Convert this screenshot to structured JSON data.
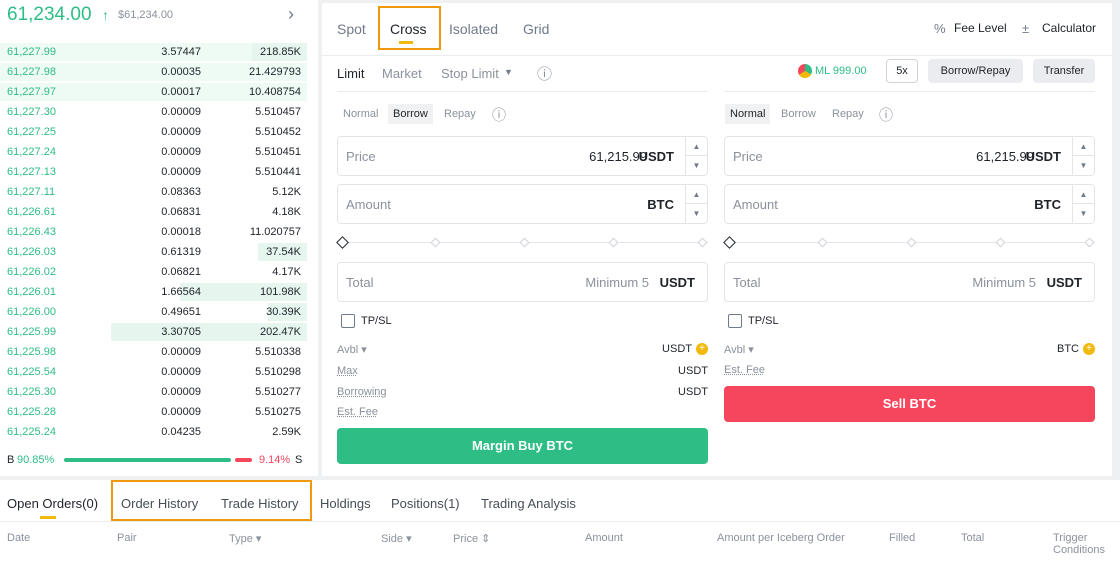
{
  "orderbook": {
    "last_price": "61,234.00",
    "arrow": "↑",
    "mark_price": "$61,234.00",
    "chevron": "›",
    "rows": [
      {
        "price": "61,227.99",
        "qty": "3.57447",
        "total": "218.85K",
        "depth": 0.28,
        "hl": true
      },
      {
        "price": "61,227.98",
        "qty": "0.00035",
        "total": "21.429793",
        "depth": 0.0,
        "hl": true
      },
      {
        "price": "61,227.97",
        "qty": "0.00017",
        "total": "10.408754",
        "depth": 0.0,
        "hl": true
      },
      {
        "price": "61,227.30",
        "qty": "0.00009",
        "total": "5.510457",
        "depth": 0.0,
        "hl": false
      },
      {
        "price": "61,227.25",
        "qty": "0.00009",
        "total": "5.510452",
        "depth": 0.0,
        "hl": false
      },
      {
        "price": "61,227.24",
        "qty": "0.00009",
        "total": "5.510451",
        "depth": 0.0,
        "hl": false
      },
      {
        "price": "61,227.13",
        "qty": "0.00009",
        "total": "5.510441",
        "depth": 0.0,
        "hl": false
      },
      {
        "price": "61,227.11",
        "qty": "0.08363",
        "total": "5.12K",
        "depth": 0.0,
        "hl": false
      },
      {
        "price": "61,226.61",
        "qty": "0.06831",
        "total": "4.18K",
        "depth": 0.0,
        "hl": false
      },
      {
        "price": "61,226.43",
        "qty": "0.00018",
        "total": "11.020757",
        "depth": 0.0,
        "hl": false
      },
      {
        "price": "61,226.03",
        "qty": "0.61319",
        "total": "37.54K",
        "depth": 0.25,
        "hl": false
      },
      {
        "price": "61,226.02",
        "qty": "0.06821",
        "total": "4.17K",
        "depth": 0.0,
        "hl": false
      },
      {
        "price": "61,226.01",
        "qty": "1.66564",
        "total": "101.98K",
        "depth": 0.65,
        "hl": false
      },
      {
        "price": "61,226.00",
        "qty": "0.49651",
        "total": "30.39K",
        "depth": 0.2,
        "hl": false
      },
      {
        "price": "61,225.99",
        "qty": "3.30705",
        "total": "202.47K",
        "depth": 1.0,
        "hl": false
      },
      {
        "price": "61,225.98",
        "qty": "0.00009",
        "total": "5.510338",
        "depth": 0.0,
        "hl": false
      },
      {
        "price": "61,225.54",
        "qty": "0.00009",
        "total": "5.510298",
        "depth": 0.0,
        "hl": false
      },
      {
        "price": "61,225.30",
        "qty": "0.00009",
        "total": "5.510277",
        "depth": 0.0,
        "hl": false
      },
      {
        "price": "61,225.28",
        "qty": "0.00009",
        "total": "5.510275",
        "depth": 0.0,
        "hl": false
      },
      {
        "price": "61,225.24",
        "qty": "0.04235",
        "total": "2.59K",
        "depth": 0.0,
        "hl": false
      }
    ],
    "ratio_buy_label": "B",
    "ratio_buy": "90.85%",
    "ratio_sell": "9.14%",
    "ratio_sell_label": "S",
    "buy_fraction": 0.9085
  },
  "tabs": {
    "spot": "Spot",
    "cross": "Cross",
    "isolated": "Isolated",
    "grid": "Grid",
    "fee_level": "Fee Level",
    "calculator": "Calculator"
  },
  "order_types": {
    "limit": "Limit",
    "market": "Market",
    "stop_limit": "Stop Limit",
    "info": "ⓘ"
  },
  "margin": {
    "ml": "ML 999.00",
    "leverage": "5x",
    "borrow_repay": "Borrow/Repay",
    "transfer": "Transfer"
  },
  "buy": {
    "mode": {
      "normal": "Normal",
      "borrow": "Borrow",
      "repay": "Repay",
      "info": "ⓘ"
    },
    "price_label": "Price",
    "price_value": "61,215.99",
    "price_unit": "USDT",
    "amount_label": "Amount",
    "amount_unit": "BTC",
    "total_label": "Total",
    "total_placeholder": "Minimum 5",
    "total_unit": "USDT",
    "tpsl": "TP/SL",
    "avbl_label": "Avbl ▾",
    "avbl_unit": "USDT",
    "max_label": "Max",
    "max_unit": "USDT",
    "borrowing_label": "Borrowing",
    "borrowing_unit": "USDT",
    "fee_label": "Est. Fee",
    "button": "Margin Buy BTC"
  },
  "sell": {
    "mode": {
      "normal": "Normal",
      "borrow": "Borrow",
      "repay": "Repay",
      "info": "ⓘ"
    },
    "price_label": "Price",
    "price_value": "61,215.99",
    "price_unit": "USDT",
    "amount_label": "Amount",
    "amount_unit": "BTC",
    "total_label": "Total",
    "total_placeholder": "Minimum 5",
    "total_unit": "USDT",
    "tpsl": "TP/SL",
    "avbl_label": "Avbl ▾",
    "avbl_unit": "BTC",
    "fee_label": "Est. Fee",
    "button": "Sell BTC"
  },
  "bottom": {
    "tabs": [
      "Open Orders(0)",
      "Order History",
      "Trade History",
      "Holdings",
      "Positions(1)",
      "Trading Analysis"
    ],
    "columns": [
      "Date",
      "Pair",
      "Type ▾",
      "Side ▾",
      "Price ⇕",
      "Amount",
      "Amount per Iceberg Order",
      "Filled",
      "Total",
      "Trigger Conditions"
    ]
  },
  "colors": {
    "buy": "#2ebd85",
    "sell": "#f6465d",
    "highlight": "#f0980e"
  }
}
